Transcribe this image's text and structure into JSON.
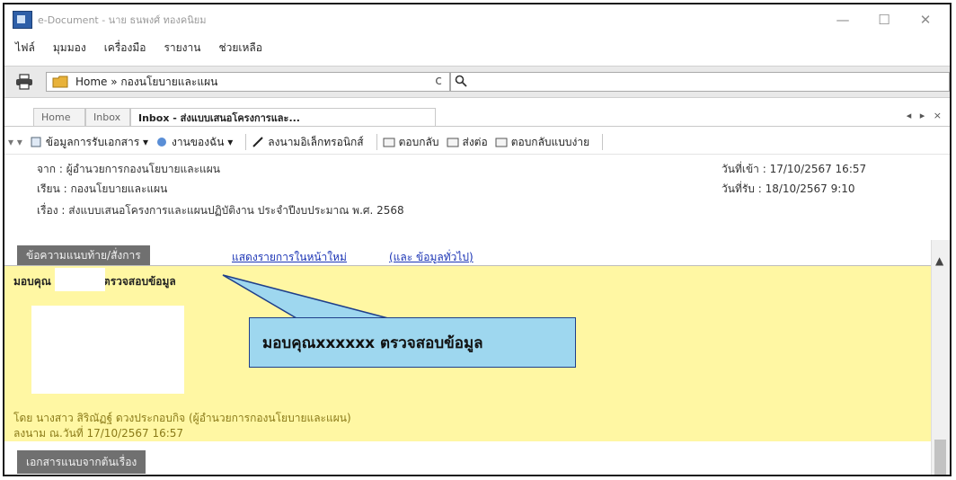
{
  "window": {
    "title": "e-Document - นาย ธนพงศ์ ทองคนิยม",
    "minimize": "—",
    "maximize": "☐",
    "close": "✕"
  },
  "menu": [
    "ไฟล์",
    "มุมมอง",
    "เครื่องมือ",
    "รายงาน",
    "ช่วยเหลือ"
  ],
  "address": {
    "path": "Home » กองนโยบายและแผน",
    "refresh": "c",
    "search_value": ""
  },
  "tabs": [
    {
      "label": "Home"
    },
    {
      "label": "Inbox"
    },
    {
      "label": "Inbox - ส่งแบบเสนอโครงการและ..."
    }
  ],
  "tab_nav": "◂ ▸ ×",
  "toolbar": {
    "dropdown": "▾ ▾",
    "receive_info": "ข้อมูลการรับเอกสาร ▾",
    "my_tasks": "งานของฉัน ▾",
    "e_signature": "ลงนามอิเล็กทรอนิกส์",
    "reply": "ตอบกลับ",
    "forward": "ส่งต่อ",
    "quick_reply": "ตอบกลับแบบง่าย"
  },
  "header": {
    "from": "จาก : ผู้อำนวยการกองนโยบายและแผน",
    "to": "เรียน : กองนโยบายและแผน",
    "subject": "เรื่อง : ส่งแบบเสนอโครงการและแผนปฏิบัติงาน ประจำปีงบประมาณ พ.ศ. 2568",
    "received": "วันที่เข้า : 17/10/2567 16:57",
    "accepted": "วันที่รับ : 18/10/2567 9:10"
  },
  "section": {
    "tab_label": "ข้อความแนบท้าย/สั่งการ",
    "link_main": "แสดงรายการในหน้าใหม่",
    "link_general": "(และ ข้อมูลทั่วไป)"
  },
  "note": {
    "line_prefix": "มอบคุณ",
    "line_suffix": "ตรวจสอบข้อมูล",
    "by": "โดย นางสาว สิริณัฏฐ์ ดวงประกอบกิจ (ผู้อำนวยการกองนโยบายและแผน)",
    "signed": "ลงนาม ณ.วันที่ 17/10/2567 16:57"
  },
  "callout": {
    "text": "มอบคุณxxxxxx ตรวจสอบข้อมูล"
  },
  "bottom": {
    "tab_label": "เอกสารแนบจากต้นเรื่อง"
  },
  "colors": {
    "note_bg": "#fff7a3",
    "callout_bg": "#9ed7ef",
    "callout_border": "#1f3f8a",
    "link": "#1c35b5",
    "section_tab": "#707070"
  }
}
